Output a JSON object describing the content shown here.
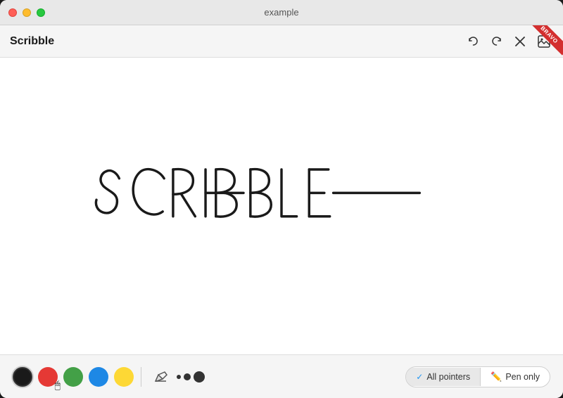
{
  "window": {
    "title": "example",
    "app_title": "Scribble",
    "badge_text": "BRAVO"
  },
  "toolbar": {
    "undo_label": "↩",
    "redo_label": "↪",
    "close_label": "✕",
    "image_label": "🖼"
  },
  "colors": [
    {
      "name": "black",
      "hex": "#1a1a1a",
      "active": true
    },
    {
      "name": "red",
      "hex": "#e53935",
      "active": false
    },
    {
      "name": "green",
      "hex": "#43a047",
      "active": false
    },
    {
      "name": "blue",
      "hex": "#1e88e5",
      "active": false
    },
    {
      "name": "yellow",
      "hex": "#fdd835",
      "active": false
    }
  ],
  "pointer_modes": [
    {
      "id": "all-pointers",
      "label": "All pointers",
      "active": true
    },
    {
      "id": "pen-only",
      "label": "Pen only",
      "active": false
    }
  ],
  "dots": [
    {
      "size": 6
    },
    {
      "size": 10
    },
    {
      "size": 16
    }
  ]
}
